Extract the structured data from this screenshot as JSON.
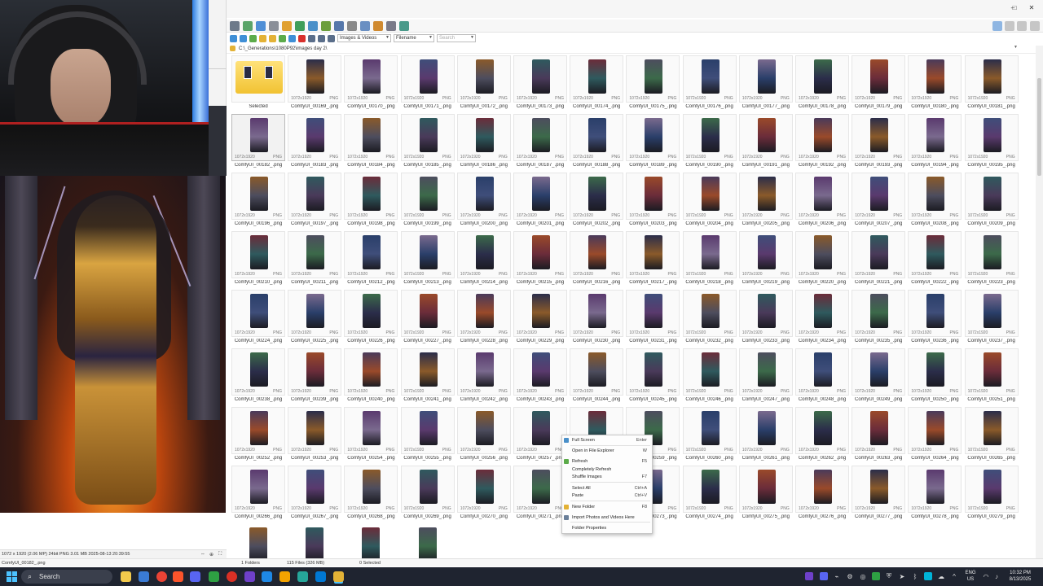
{
  "colors": {
    "accent": "#0078d4",
    "taskbar": "#1f2430",
    "folder": "#f1c232",
    "thumb_palette": [
      "#2b2d4a",
      "#5a3a6e",
      "#3f4e7a",
      "#8a5a2a",
      "#2f5a5e",
      "#6b2c3a",
      "#4d4d5e",
      "#2a3f6a",
      "#7a6a8e",
      "#3c6a4a",
      "#9a4a2a",
      "#4a3a5a"
    ]
  },
  "window": {
    "controls": {
      "minimize": "–",
      "maximize": "□",
      "close": "✕"
    }
  },
  "toolbar": {
    "filter_select": "Images & Videos",
    "sort_select": "Filename",
    "search_placeholder": "Search"
  },
  "path": {
    "text": "C:\\_Generations\\1080P92\\images day 2\\"
  },
  "thumbnail": {
    "dims": "1072x1920",
    "format": "PNG"
  },
  "folder_tile": {
    "label": "Selected",
    "icon": "folder-icon"
  },
  "files": [
    "ComfyUI_00169_.png",
    "ComfyUI_00170_.png",
    "ComfyUI_00171_.png",
    "ComfyUI_00172_.png",
    "ComfyUI_00173_.png",
    "ComfyUI_00174_.png",
    "ComfyUI_00175_.png",
    "ComfyUI_00176_.png",
    "ComfyUI_00177_.png",
    "ComfyUI_00178_.png",
    "ComfyUI_00179_.png",
    "ComfyUI_00180_.png",
    "ComfyUI_00181_.png",
    "ComfyUI_00182_.png",
    "ComfyUI_00183_.png",
    "ComfyUI_00184_.png",
    "ComfyUI_00185_.png",
    "ComfyUI_00186_.png",
    "ComfyUI_00187_.png",
    "ComfyUI_00188_.png",
    "ComfyUI_00189_.png",
    "ComfyUI_00190_.png",
    "ComfyUI_00191_.png",
    "ComfyUI_00192_.png",
    "ComfyUI_00193_.png",
    "ComfyUI_00194_.png",
    "ComfyUI_00195_.png",
    "ComfyUI_00196_.png",
    "ComfyUI_00197_.png",
    "ComfyUI_00198_.png",
    "ComfyUI_00199_.png",
    "ComfyUI_00200_.png",
    "ComfyUI_00201_.png",
    "ComfyUI_00202_.png",
    "ComfyUI_00203_.png",
    "ComfyUI_00204_.png",
    "ComfyUI_00205_.png",
    "ComfyUI_00206_.png",
    "ComfyUI_00207_.png",
    "ComfyUI_00208_.png",
    "ComfyUI_00209_.png",
    "ComfyUI_00210_.png",
    "ComfyUI_00211_.png",
    "ComfyUI_00212_.png",
    "ComfyUI_00213_.png",
    "ComfyUI_00214_.png",
    "ComfyUI_00215_.png",
    "ComfyUI_00216_.png",
    "ComfyUI_00217_.png",
    "ComfyUI_00218_.png",
    "ComfyUI_00219_.png",
    "ComfyUI_00220_.png",
    "ComfyUI_00221_.png",
    "ComfyUI_00222_.png",
    "ComfyUI_00223_.png",
    "ComfyUI_00224_.png",
    "ComfyUI_00225_.png",
    "ComfyUI_00226_.png",
    "ComfyUI_00227_.png",
    "ComfyUI_00228_.png",
    "ComfyUI_00229_.png",
    "ComfyUI_00230_.png",
    "ComfyUI_00231_.png",
    "ComfyUI_00232_.png",
    "ComfyUI_00233_.png",
    "ComfyUI_00234_.png",
    "ComfyUI_00235_.png",
    "ComfyUI_00236_.png",
    "ComfyUI_00237_.png",
    "ComfyUI_00238_.png",
    "ComfyUI_00239_.png",
    "ComfyUI_00240_.png",
    "ComfyUI_00241_.png",
    "ComfyUI_00242_.png",
    "ComfyUI_00243_.png",
    "ComfyUI_00244_.png",
    "ComfyUI_00245_.png",
    "ComfyUI_00246_.png",
    "ComfyUI_00247_.png",
    "ComfyUI_00248_.png",
    "ComfyUI_00249_.png",
    "ComfyUI_00250_.png",
    "ComfyUI_00251_.png",
    "ComfyUI_00252_.png",
    "ComfyUI_00253_.png",
    "ComfyUI_00254_.png",
    "ComfyUI_00255_.png",
    "ComfyUI_00256_.png",
    "ComfyUI_00257_.png",
    "ComfyUI_00258_.png",
    "ComfyUI_00259_.png",
    "ComfyUI_00260_.png",
    "ComfyUI_00261_.png",
    "ComfyUI_00262_.png",
    "ComfyUI_00263_.png",
    "ComfyUI_00264_.png",
    "ComfyUI_00265_.png",
    "ComfyUI_00266_.png",
    "ComfyUI_00267_.png",
    "ComfyUI_00268_.png",
    "ComfyUI_00269_.png",
    "ComfyUI_00270_.png",
    "ComfyUI_00271_.png",
    "ComfyUI_00272_.png",
    "ComfyUI_00273_.png",
    "ComfyUI_00274_.png",
    "ComfyUI_00275_.png",
    "ComfyUI_00276_.png",
    "ComfyUI_00277_.png",
    "ComfyUI_00278_.png",
    "ComfyUI_00279_.png",
    "",
    "",
    "",
    ""
  ],
  "context_menu": {
    "items": [
      {
        "label": "Full Screen",
        "shortcut": "Enter",
        "icon": "fullscreen-icon"
      },
      {
        "label": "Open in File Explorer",
        "shortcut": "W",
        "icon": ""
      },
      {
        "label": "Refresh",
        "shortcut": "F5",
        "icon": "refresh-icon"
      },
      {
        "label": "Completely Refresh",
        "shortcut": "",
        "icon": ""
      },
      {
        "label": "Shuffle Images",
        "shortcut": "F7",
        "icon": ""
      },
      {
        "label": "Select All",
        "shortcut": "Ctrl+A",
        "icon": ""
      },
      {
        "label": "Paste",
        "shortcut": "Ctrl+V",
        "icon": ""
      },
      {
        "label": "New Folder",
        "shortcut": "F8",
        "icon": "new-folder-icon"
      },
      {
        "label": "Import Photos and Videos Here",
        "shortcut": "",
        "icon": "import-icon"
      },
      {
        "label": "Folder Properties",
        "shortcut": "",
        "icon": ""
      }
    ]
  },
  "left_status": {
    "text": "1072 x 1920 (2.06 MP)  24bit  PNG    3.01 MB    2025-08-13 20:39:55"
  },
  "file_strip": {
    "text": "ComfyUI_00182_.png"
  },
  "status": {
    "folders": "1 Folders",
    "files": "115 Files (326 MB)",
    "selected": "0 Selected"
  },
  "taskbar": {
    "search_label": "Search",
    "language": "ENG",
    "region": "US",
    "time": "10:32 PM",
    "date": "8/13/2025"
  }
}
